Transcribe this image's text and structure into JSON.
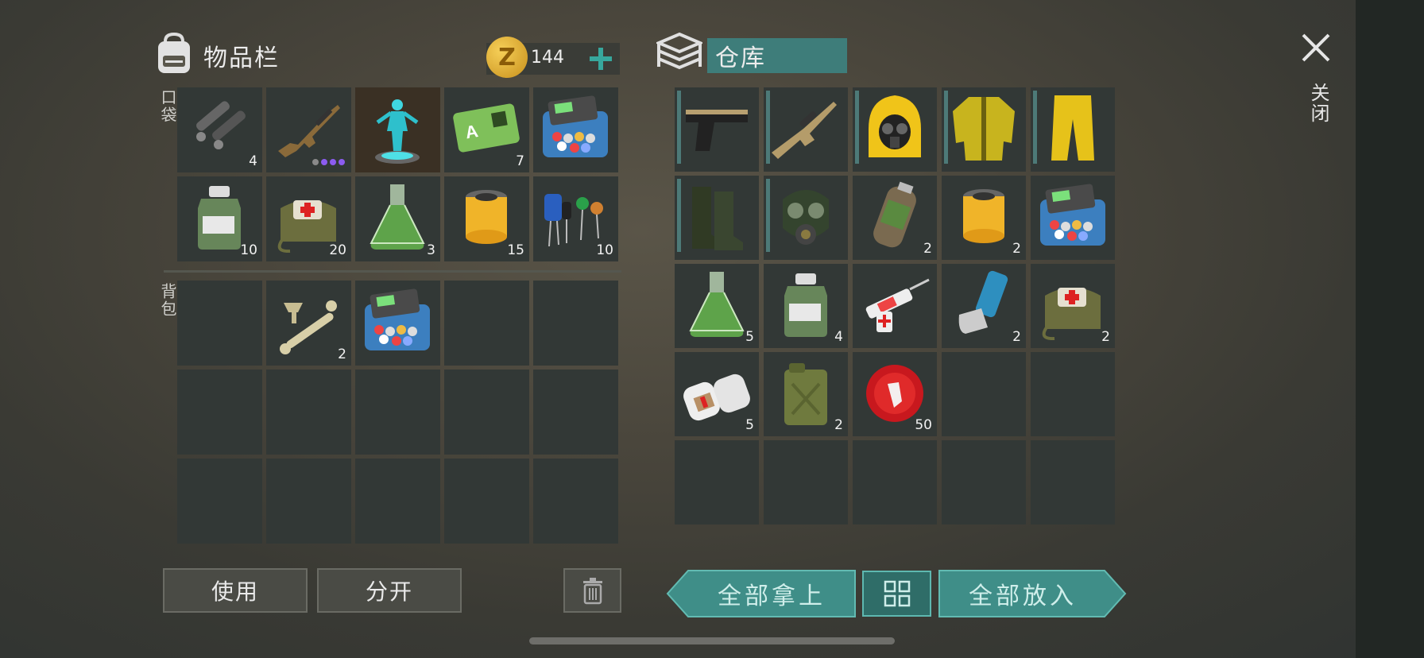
{
  "inventory": {
    "title": "物品栏",
    "coins": "144",
    "coin_symbol": "Z",
    "pocket_label": "口袋",
    "backpack_label": "背包",
    "pocket_items": [
      {
        "icon": "pipes-icon",
        "count": "4"
      },
      {
        "icon": "assault-rifle-icon",
        "count": "",
        "quality_dots": 4,
        "quality_filled": 3
      },
      {
        "icon": "hologram-figure-icon",
        "count": ""
      },
      {
        "icon": "sector-a-keycard-icon",
        "count": "7"
      },
      {
        "icon": "electronics-kit-icon",
        "count": ""
      },
      {
        "icon": "acid-bottle-icon",
        "count": "10"
      },
      {
        "icon": "first-aid-bag-icon",
        "count": "20"
      },
      {
        "icon": "chemical-flask-icon",
        "count": "3"
      },
      {
        "icon": "filter-icon",
        "count": "15"
      },
      {
        "icon": "capacitors-icon",
        "count": "10"
      }
    ],
    "backpack_items": [
      {
        "icon": "",
        "count": ""
      },
      {
        "icon": "bones-icon",
        "count": "2"
      },
      {
        "icon": "electronics-kit-icon",
        "count": ""
      },
      {
        "icon": "",
        "count": ""
      },
      {
        "icon": "",
        "count": ""
      },
      {
        "icon": "",
        "count": ""
      },
      {
        "icon": "",
        "count": ""
      },
      {
        "icon": "",
        "count": ""
      },
      {
        "icon": "",
        "count": ""
      },
      {
        "icon": "",
        "count": ""
      },
      {
        "icon": "",
        "count": ""
      },
      {
        "icon": "",
        "count": ""
      },
      {
        "icon": "",
        "count": ""
      },
      {
        "icon": "",
        "count": ""
      },
      {
        "icon": "",
        "count": ""
      }
    ],
    "use_label": "使用",
    "split_label": "分开"
  },
  "storage": {
    "title": "仓库",
    "items": [
      {
        "icon": "pistol-icon",
        "count": "",
        "equipped": true
      },
      {
        "icon": "sniper-rifle-icon",
        "count": "",
        "equipped": true
      },
      {
        "icon": "hazmat-hood-icon",
        "count": "",
        "equipped": true
      },
      {
        "icon": "hazmat-jacket-icon",
        "count": "",
        "equipped": true
      },
      {
        "icon": "hazmat-pants-icon",
        "count": "",
        "equipped": true
      },
      {
        "icon": "rubber-boots-icon",
        "count": "",
        "equipped": true
      },
      {
        "icon": "gas-mask-icon",
        "count": "",
        "equipped": true
      },
      {
        "icon": "gas-canister-icon",
        "count": "2"
      },
      {
        "icon": "filter-icon",
        "count": "2"
      },
      {
        "icon": "electronics-kit-icon",
        "count": ""
      },
      {
        "icon": "chemical-flask-icon",
        "count": "5"
      },
      {
        "icon": "acid-bottle-icon",
        "count": "4"
      },
      {
        "icon": "syringe-icon",
        "count": ""
      },
      {
        "icon": "inhaler-icon",
        "count": "2"
      },
      {
        "icon": "first-aid-bag-icon",
        "count": "2"
      },
      {
        "icon": "bandage-icon",
        "count": "5"
      },
      {
        "icon": "jerry-can-icon",
        "count": "2"
      },
      {
        "icon": "bottle-cap-icon",
        "count": "50"
      },
      {
        "icon": "",
        "count": ""
      },
      {
        "icon": "",
        "count": ""
      },
      {
        "icon": "",
        "count": ""
      },
      {
        "icon": "",
        "count": ""
      },
      {
        "icon": "",
        "count": ""
      },
      {
        "icon": "",
        "count": ""
      },
      {
        "icon": "",
        "count": ""
      }
    ],
    "take_all_label": "全部拿上",
    "put_all_label": "全部放入"
  },
  "close_label": "关闭",
  "colors": {
    "accent": "#3f8e88",
    "slot": "#323836",
    "equipped_bar": "#4d7a78",
    "coin": "#d9a42a"
  }
}
